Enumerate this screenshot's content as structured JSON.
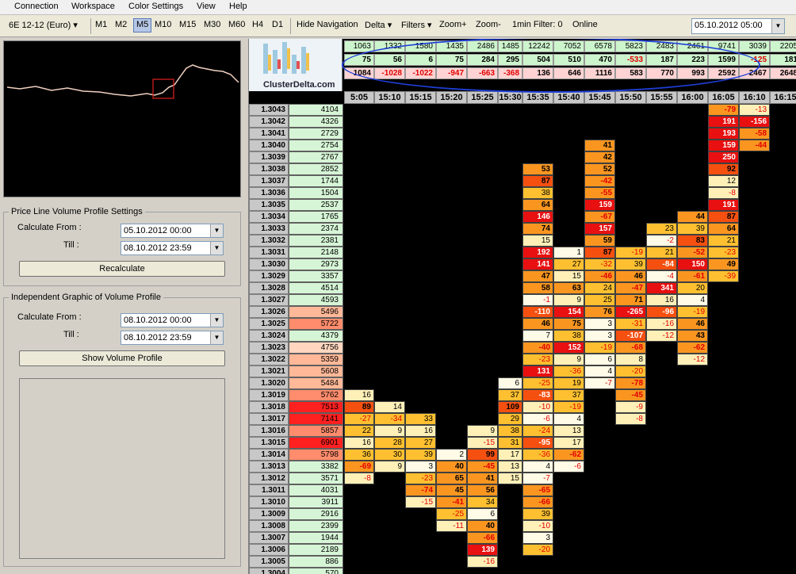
{
  "menu": [
    "Connection",
    "Workspace",
    "Color Settings",
    "View",
    "Help"
  ],
  "toolbar": {
    "instrument": "6E 12-12 (Euro)",
    "timeframes": [
      "M1",
      "M2",
      "M5",
      "M10",
      "M15",
      "M30",
      "M60",
      "H4",
      "D1"
    ],
    "active_timeframe": "M5",
    "hide_nav": "Hide Navigation",
    "delta": "Delta",
    "filters": "Filters",
    "zoom_in": "Zoom+",
    "zoom_out": "Zoom-",
    "min_filter": "1min Filter: 0",
    "status": "Online",
    "datetime": "05.10.2012 05:00"
  },
  "left": {
    "price_line_title": "Price Line Volume Profile Settings",
    "calc_from_label": "Calculate From :",
    "till_label": "Till :",
    "calc_from": "05.10.2012 00:00",
    "till": "08.10.2012 23:59",
    "recalculate": "Recalculate",
    "independent_title": "Independent Graphic of Volume Profile",
    "ind_calc_from": "08.10.2012 00:00",
    "ind_till": "08.10.2012 23:59",
    "show_profile": "Show Volume Profile"
  },
  "logo_text": "ClusterDelta.com",
  "colors": {
    "accent": "#1f3fd8",
    "volume_row": "#cdf5cd",
    "delta_row": "#ffd3d3",
    "neg_text": "#e00000"
  },
  "columns": [
    {
      "time": "5:05",
      "volume": "1063",
      "delta": "75",
      "cum_delta": "1084"
    },
    {
      "time": "15:10",
      "volume": "1332",
      "delta": "56",
      "cum_delta": "-1028"
    },
    {
      "time": "15:15",
      "volume": "1580",
      "delta": "6",
      "cum_delta": "-1022"
    },
    {
      "time": "15:20",
      "volume": "1435",
      "delta": "75",
      "cum_delta": "-947"
    },
    {
      "time": "15:25",
      "volume": "2486",
      "delta": "284",
      "cum_delta": "-663"
    },
    {
      "time": "15:30",
      "volume": "1485",
      "delta": "295",
      "cum_delta": "-368"
    },
    {
      "time": "15:35",
      "volume": "12242",
      "delta": "504",
      "cum_delta": "136"
    },
    {
      "time": "15:40",
      "volume": "7052",
      "delta": "510",
      "cum_delta": "646"
    },
    {
      "time": "15:45",
      "volume": "6578",
      "delta": "470",
      "cum_delta": "1116"
    },
    {
      "time": "15:50",
      "volume": "5823",
      "delta": "-533",
      "cum_delta": "583"
    },
    {
      "time": "15:55",
      "volume": "2483",
      "delta": "187",
      "cum_delta": "770"
    },
    {
      "time": "16:00",
      "volume": "2461",
      "delta": "223",
      "cum_delta": "993"
    },
    {
      "time": "16:05",
      "volume": "9741",
      "delta": "1599",
      "cum_delta": "2592"
    },
    {
      "time": "16:10",
      "volume": "3039",
      "delta": "-125",
      "cum_delta": "2467"
    },
    {
      "time": "16:15",
      "volume": "2205",
      "delta": "181",
      "cum_delta": "2648"
    }
  ],
  "prices": [
    {
      "p": "1.3043",
      "v": "4104",
      "c": [
        "",
        "",
        "",
        "",
        "",
        "",
        "",
        "",
        "",
        "",
        "",
        "",
        "-79",
        "-13",
        ""
      ]
    },
    {
      "p": "1.3042",
      "v": "4326",
      "c": [
        "",
        "",
        "",
        "",
        "",
        "",
        "",
        "",
        "",
        "",
        "",
        "",
        "191",
        "-156",
        ""
      ]
    },
    {
      "p": "1.3041",
      "v": "2729",
      "c": [
        "",
        "",
        "",
        "",
        "",
        "",
        "",
        "",
        "",
        "",
        "",
        "",
        "193",
        "-58",
        ""
      ]
    },
    {
      "p": "1.3040",
      "v": "2754",
      "c": [
        "",
        "",
        "",
        "",
        "",
        "",
        "",
        "",
        "41",
        "",
        "",
        "",
        "159",
        "-44",
        ""
      ]
    },
    {
      "p": "1.3039",
      "v": "2767",
      "c": [
        "",
        "",
        "",
        "",
        "",
        "",
        "",
        "",
        "42",
        "",
        "",
        "",
        "250",
        "",
        ""
      ]
    },
    {
      "p": "1.3038",
      "v": "2852",
      "c": [
        "",
        "",
        "",
        "",
        "",
        "",
        "53",
        "",
        "52",
        "",
        "",
        "",
        "92",
        "",
        ""
      ]
    },
    {
      "p": "1.3037",
      "v": "1744",
      "c": [
        "",
        "",
        "",
        "",
        "",
        "",
        "87",
        "",
        "-42",
        "",
        "",
        "",
        "12",
        "",
        ""
      ]
    },
    {
      "p": "1.3036",
      "v": "1504",
      "c": [
        "",
        "",
        "",
        "",
        "",
        "",
        "38",
        "",
        "-55",
        "",
        "",
        "",
        "-8",
        "",
        ""
      ]
    },
    {
      "p": "1.3035",
      "v": "2537",
      "c": [
        "",
        "",
        "",
        "",
        "",
        "",
        "64",
        "",
        "159",
        "",
        "",
        "",
        "191",
        "",
        ""
      ]
    },
    {
      "p": "1.3034",
      "v": "1765",
      "c": [
        "",
        "",
        "",
        "",
        "",
        "",
        "146",
        "",
        "-67",
        "",
        "",
        "44",
        "87",
        "",
        ""
      ]
    },
    {
      "p": "1.3033",
      "v": "2374",
      "c": [
        "",
        "",
        "",
        "",
        "",
        "",
        "74",
        "",
        "157",
        "",
        "23",
        "39",
        "64",
        "",
        ""
      ]
    },
    {
      "p": "1.3032",
      "v": "2381",
      "c": [
        "",
        "",
        "",
        "",
        "",
        "",
        "15",
        "",
        "59",
        "",
        "-2",
        "83",
        "21",
        "",
        ""
      ]
    },
    {
      "p": "1.3031",
      "v": "2148",
      "c": [
        "",
        "",
        "",
        "",
        "",
        "",
        "192",
        "1",
        "87",
        "-19",
        "21",
        "-52",
        "-23",
        "",
        ""
      ]
    },
    {
      "p": "1.3030",
      "v": "2973",
      "c": [
        "",
        "",
        "",
        "",
        "",
        "",
        "141",
        "27",
        "-32",
        "39",
        "-84",
        "150",
        "49",
        "",
        ""
      ]
    },
    {
      "p": "1.3029",
      "v": "3357",
      "c": [
        "",
        "",
        "",
        "",
        "",
        "",
        "47",
        "15",
        "-46",
        "46",
        "-4",
        "-61",
        "-39",
        "",
        ""
      ]
    },
    {
      "p": "1.3028",
      "v": "4514",
      "c": [
        "",
        "",
        "",
        "",
        "",
        "",
        "58",
        "63",
        "24",
        "-47",
        "341",
        "20",
        "",
        "",
        ""
      ]
    },
    {
      "p": "1.3027",
      "v": "4593",
      "c": [
        "",
        "",
        "",
        "",
        "",
        "",
        "-1",
        "9",
        "25",
        "71",
        "16",
        "4",
        "",
        "",
        ""
      ]
    },
    {
      "p": "1.3026",
      "v": "5496",
      "c": [
        "",
        "",
        "",
        "",
        "",
        "",
        "-110",
        "154",
        "76",
        "-265",
        "-96",
        "-19",
        "",
        "",
        ""
      ]
    },
    {
      "p": "1.3025",
      "v": "5722",
      "c": [
        "",
        "",
        "",
        "",
        "",
        "",
        "46",
        "75",
        "3",
        "-31",
        "-16",
        "46",
        "",
        "",
        ""
      ]
    },
    {
      "p": "1.3024",
      "v": "4379",
      "c": [
        "",
        "",
        "",
        "",
        "",
        "",
        "7",
        "38",
        "3",
        "-107",
        "-12",
        "43",
        "",
        "",
        ""
      ]
    },
    {
      "p": "1.3023",
      "v": "4756",
      "c": [
        "",
        "",
        "",
        "",
        "",
        "",
        "-40",
        "152",
        "-19",
        "-68",
        "",
        "-62",
        "",
        "",
        ""
      ]
    },
    {
      "p": "1.3022",
      "v": "5359",
      "c": [
        "",
        "",
        "",
        "",
        "",
        "",
        "-23",
        "9",
        "6",
        "8",
        "",
        "-12",
        "",
        "",
        ""
      ]
    },
    {
      "p": "1.3021",
      "v": "5608",
      "c": [
        "",
        "",
        "",
        "",
        "",
        "",
        "131",
        "-36",
        "4",
        "-20",
        "",
        "",
        "",
        "",
        ""
      ]
    },
    {
      "p": "1.3020",
      "v": "5484",
      "c": [
        "",
        "",
        "",
        "",
        "",
        "6",
        "-25",
        "19",
        "-7",
        "-78",
        "",
        "",
        "",
        "",
        ""
      ]
    },
    {
      "p": "1.3019",
      "v": "5762",
      "c": [
        "16",
        "",
        "",
        "",
        "",
        "37",
        "-83",
        "37",
        "",
        "-45",
        "",
        "",
        "",
        "",
        ""
      ]
    },
    {
      "p": "1.3018",
      "v": "7513",
      "c": [
        "89",
        "14",
        "",
        "",
        "",
        "109",
        "-10",
        "-19",
        "",
        "-9",
        "",
        "",
        "",
        "",
        ""
      ]
    },
    {
      "p": "1.3017",
      "v": "7141",
      "c": [
        "-27",
        "-34",
        "33",
        "",
        "",
        "29",
        "-6",
        "4",
        "",
        "-8",
        "",
        "",
        "",
        "",
        ""
      ]
    },
    {
      "p": "1.3016",
      "v": "5857",
      "c": [
        "22",
        "9",
        "16",
        "",
        "9",
        "38",
        "-24",
        "13",
        "",
        "",
        "",
        "",
        "",
        "",
        ""
      ]
    },
    {
      "p": "1.3015",
      "v": "6901",
      "c": [
        "16",
        "28",
        "27",
        "",
        "-15",
        "31",
        "-95",
        "17",
        "",
        "",
        "",
        "",
        "",
        "",
        ""
      ]
    },
    {
      "p": "1.3014",
      "v": "5798",
      "c": [
        "36",
        "30",
        "39",
        "2",
        "99",
        "17",
        "-36",
        "-62",
        "",
        "",
        "",
        "",
        "",
        "",
        ""
      ]
    },
    {
      "p": "1.3013",
      "v": "3382",
      "c": [
        "-69",
        "9",
        "3",
        "40",
        "-45",
        "13",
        "4",
        "-6",
        "",
        "",
        "",
        "",
        "",
        "",
        ""
      ]
    },
    {
      "p": "1.3012",
      "v": "3571",
      "c": [
        "-8",
        "",
        "-23",
        "65",
        "41",
        "15",
        "-7",
        "",
        "",
        "",
        "",
        "",
        "",
        "",
        ""
      ]
    },
    {
      "p": "1.3011",
      "v": "4031",
      "c": [
        "",
        "",
        "-74",
        "45",
        "56",
        "",
        "-65",
        "",
        "",
        "",
        "",
        "",
        "",
        "",
        ""
      ]
    },
    {
      "p": "1.3010",
      "v": "3911",
      "c": [
        "",
        "",
        "-15",
        "-41",
        "34",
        "",
        "-66",
        "",
        "",
        "",
        "",
        "",
        "",
        "",
        ""
      ]
    },
    {
      "p": "1.3009",
      "v": "2916",
      "c": [
        "",
        "",
        "",
        "-25",
        "6",
        "",
        "39",
        "",
        "",
        "",
        "",
        "",
        "",
        "",
        ""
      ]
    },
    {
      "p": "1.3008",
      "v": "2399",
      "c": [
        "",
        "",
        "",
        "-11",
        "40",
        "",
        "-10",
        "",
        "",
        "",
        "",
        "",
        "",
        "",
        ""
      ]
    },
    {
      "p": "1.3007",
      "v": "1944",
      "c": [
        "",
        "",
        "",
        "",
        "-66",
        "",
        "3",
        "",
        "",
        "",
        "",
        "",
        "",
        "",
        ""
      ]
    },
    {
      "p": "1.3006",
      "v": "2189",
      "c": [
        "",
        "",
        "",
        "",
        "139",
        "",
        "-20",
        "",
        "",
        "",
        "",
        "",
        "",
        "",
        ""
      ]
    },
    {
      "p": "1.3005",
      "v": "886",
      "c": [
        "",
        "",
        "",
        "",
        "-16",
        "",
        "",
        "",
        "",
        "",
        "",
        "",
        "",
        "",
        ""
      ]
    },
    {
      "p": "1.3004",
      "v": "570",
      "c": [
        "",
        "",
        "",
        "",
        "",
        "",
        "",
        "",
        "",
        "",
        "",
        "",
        "",
        "",
        ""
      ]
    }
  ]
}
